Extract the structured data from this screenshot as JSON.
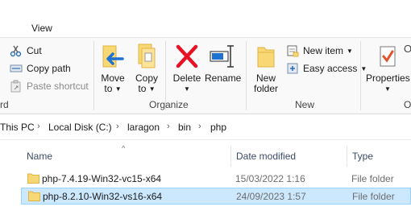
{
  "tabs": {
    "view_label": "View"
  },
  "clipboard": {
    "cut_label": "Cut",
    "copy_path_label": "Copy path",
    "paste_shortcut_label": "Paste shortcut",
    "group_label_fragment": "rd"
  },
  "organize": {
    "move_to_line1": "Move",
    "move_to_line2": "to",
    "copy_to_line1": "Copy",
    "copy_to_line2": "to",
    "delete_label": "Delete",
    "rename_label": "Rename",
    "group_label": "Organize"
  },
  "new": {
    "new_folder_line1": "New",
    "new_folder_line2": "folder",
    "new_item_label": "New item",
    "easy_access_label": "Easy access",
    "group_label": "New"
  },
  "open": {
    "properties_label": "Properties",
    "group_label_fragment": "O",
    "open_fragment": "O"
  },
  "address": {
    "crumbs": [
      "This PC",
      "Local Disk (C:)",
      "laragon",
      "bin",
      "php"
    ]
  },
  "list": {
    "columns": {
      "name": "Name",
      "date": "Date modified",
      "type": "Type"
    },
    "rows": [
      {
        "name": "php-7.4.19-Win32-vc15-x64",
        "date": "15/03/2022 1:16",
        "type": "File folder"
      },
      {
        "name": "php-8.2.10-Win32-vs16-x64",
        "date": "24/09/2023 1:57",
        "type": "File folder"
      }
    ]
  },
  "colors": {
    "folder": "#f8d775",
    "folder_dark": "#e0b443",
    "selection": "#cce8ff",
    "delete_red": "#e81123",
    "arrow_blue": "#1e73d2"
  }
}
